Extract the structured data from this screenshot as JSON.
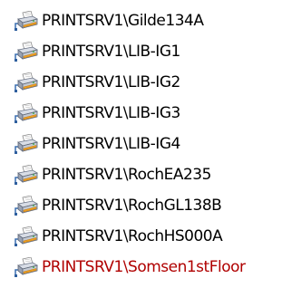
{
  "printers": [
    {
      "name": "PRINTSRV1\\Gilde134A",
      "icon": "network-printer-icon",
      "color": "#000000"
    },
    {
      "name": "PRINTSRV1\\LIB-IG1",
      "icon": "network-printer-icon",
      "color": "#000000"
    },
    {
      "name": "PRINTSRV1\\LIB-IG2",
      "icon": "network-printer-icon",
      "color": "#000000"
    },
    {
      "name": "PRINTSRV1\\LIB-IG3",
      "icon": "network-printer-icon",
      "color": "#000000"
    },
    {
      "name": "PRINTSRV1\\LIB-IG4",
      "icon": "network-printer-icon",
      "color": "#000000"
    },
    {
      "name": "PRINTSRV1\\RochEA235",
      "icon": "network-printer-icon",
      "color": "#000000"
    },
    {
      "name": "PRINTSRV1\\RochGL138B",
      "icon": "network-printer-icon",
      "color": "#000000"
    },
    {
      "name": "PRINTSRV1\\RochHS000A",
      "icon": "network-printer-icon",
      "color": "#000000"
    },
    {
      "name": "PRINTSRV1\\Somsen1stFloor",
      "icon": "network-printer-icon",
      "color": "#b00000"
    }
  ]
}
